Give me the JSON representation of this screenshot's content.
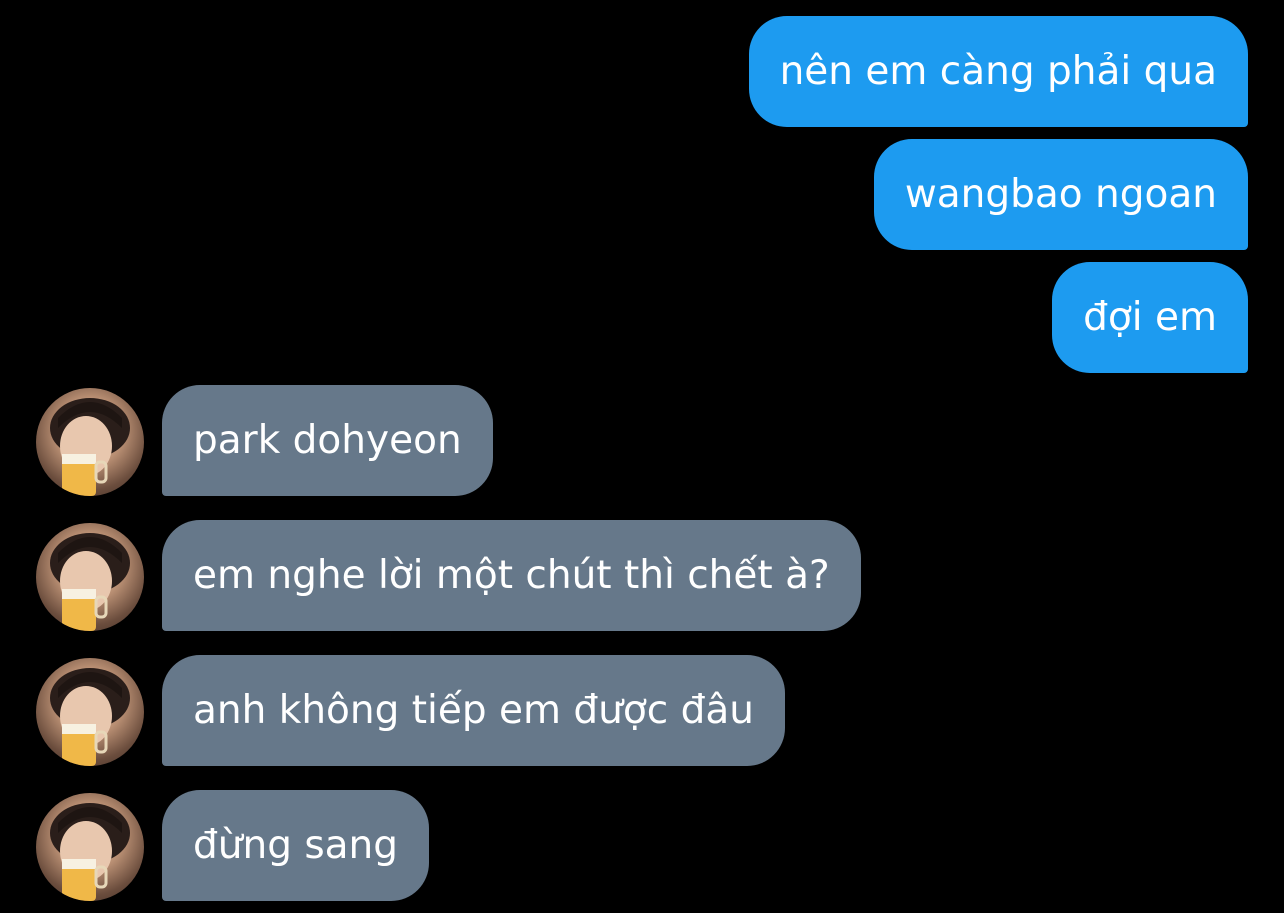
{
  "colors": {
    "background": "#000000",
    "outgoing_bubble": "#1d9bf0",
    "incoming_bubble": "#66788a",
    "text": "#ffffff"
  },
  "outgoing_messages": [
    {
      "text": "nên em càng phải qua"
    },
    {
      "text": "wangbao ngoan"
    },
    {
      "text": "đợi em"
    }
  ],
  "incoming_messages": [
    {
      "text": "park dohyeon",
      "avatar": "profile-photo"
    },
    {
      "text": "em nghe lời một chút thì chết à?",
      "avatar": "profile-photo"
    },
    {
      "text": "anh không tiếp em được đâu",
      "avatar": "profile-photo"
    },
    {
      "text": "đừng sang",
      "avatar": "profile-photo"
    }
  ]
}
